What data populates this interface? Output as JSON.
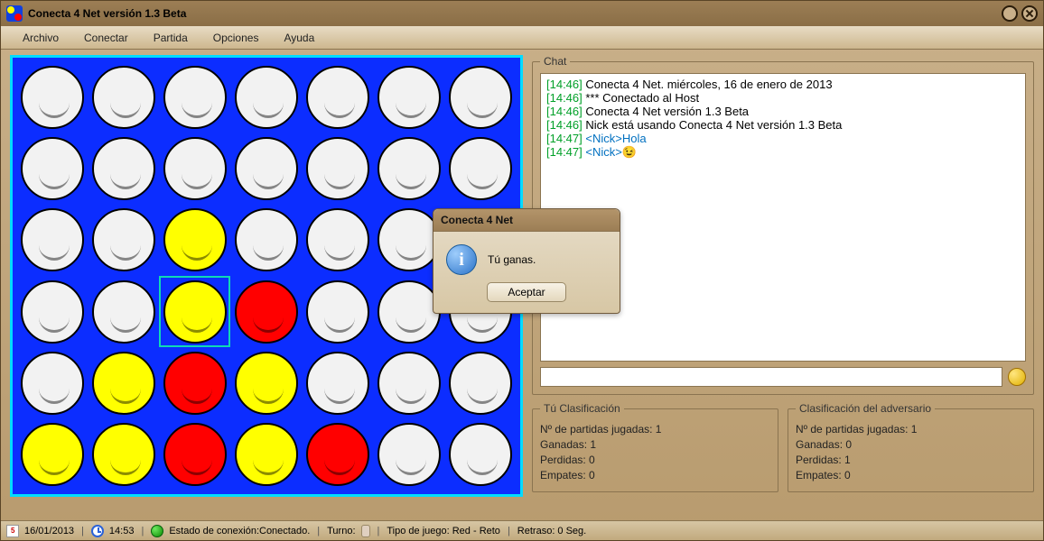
{
  "window": {
    "title": "Conecta 4 Net versión 1.3 Beta"
  },
  "menu": {
    "items": [
      "Archivo",
      "Conectar",
      "Partida",
      "Opciones",
      "Ayuda"
    ]
  },
  "board": {
    "grid": [
      [
        "e",
        "e",
        "e",
        "e",
        "e",
        "e",
        "e"
      ],
      [
        "e",
        "e",
        "e",
        "e",
        "e",
        "e",
        "e"
      ],
      [
        "e",
        "e",
        "y",
        "e",
        "e",
        "e",
        "e"
      ],
      [
        "e",
        "e",
        "y",
        "r",
        "e",
        "e",
        "e"
      ],
      [
        "e",
        "y",
        "r",
        "y",
        "e",
        "e",
        "e"
      ],
      [
        "y",
        "y",
        "r",
        "y",
        "r",
        "e",
        "e"
      ]
    ],
    "highlight": {
      "row": 3,
      "col": 2
    }
  },
  "chat": {
    "legend": "Chat",
    "lines": [
      {
        "ts": "[14:46]",
        "text": " Conecta 4 Net. miércoles, 16 de enero de 2013"
      },
      {
        "ts": "[14:46]",
        "text": " *** Conectado al Host"
      },
      {
        "ts": "[14:46]",
        "text": " Conecta 4 Net versión 1.3 Beta"
      },
      {
        "ts": "[14:46]",
        "text": " Nick está usando Conecta 4 Net versión 1.3 Beta"
      },
      {
        "ts": "[14:47]",
        "text": " <Nick>Hola",
        "special": true
      },
      {
        "ts": "[14:47]",
        "text": " <Nick>😉",
        "special": true
      }
    ],
    "input_value": ""
  },
  "stats": {
    "you": {
      "legend": "Tú Clasificación",
      "played": "Nº de partidas jugadas: 1",
      "won": "Ganadas: 1",
      "lost": "Perdidas: 0",
      "draws": "Empates: 0"
    },
    "opp": {
      "legend": "Clasificación del adversario",
      "played": "Nº de partidas jugadas: 1",
      "won": "Ganadas: 0",
      "lost": "Perdidas: 1",
      "draws": "Empates: 0"
    }
  },
  "dialog": {
    "title": "Conecta 4 Net",
    "message": "Tú ganas.",
    "ok_label": "Aceptar"
  },
  "statusbar": {
    "date": "16/01/2013",
    "time": "14:53",
    "conn": "Estado de conexión:Conectado.",
    "turn_label": "Turno:",
    "game_type": "Tipo de juego:  Red - Reto",
    "delay": "Retraso: 0 Seg."
  }
}
